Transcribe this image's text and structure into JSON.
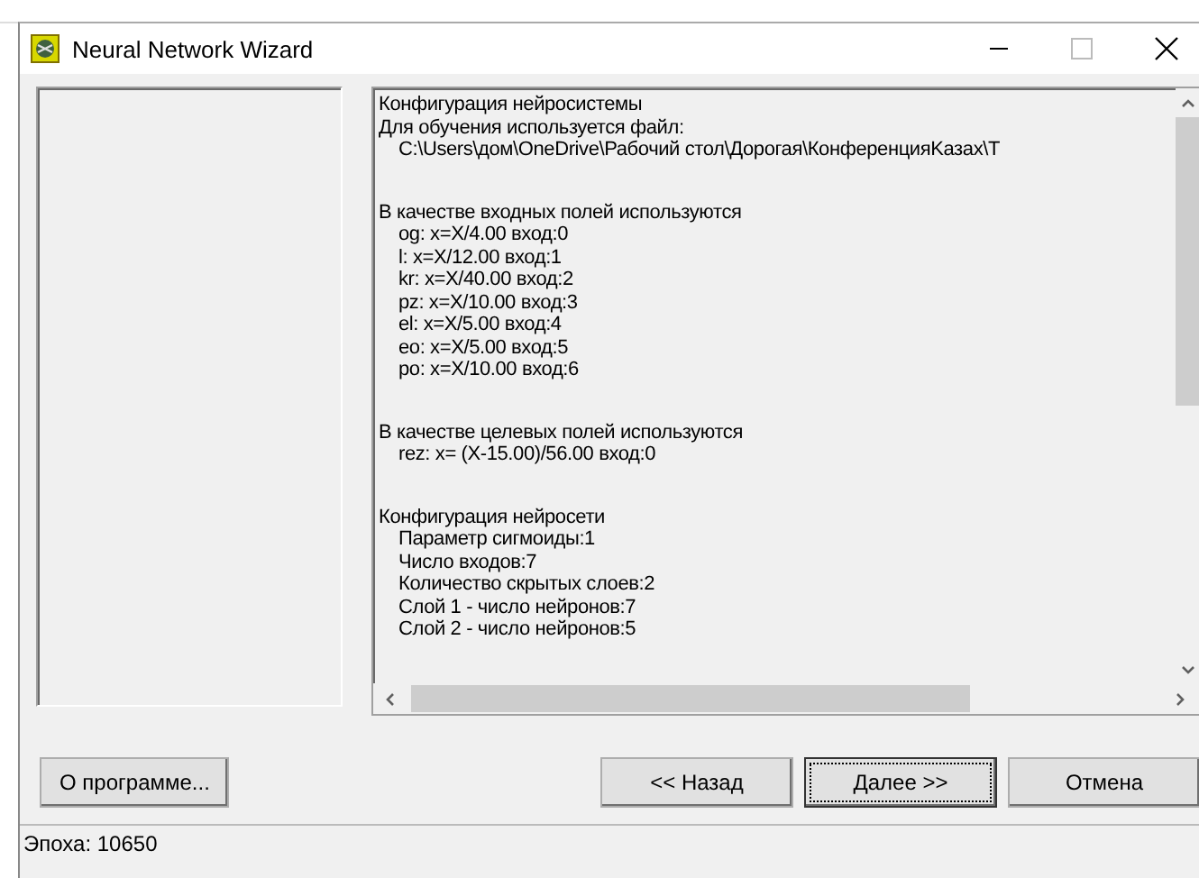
{
  "window": {
    "title": "Neural Network Wizard"
  },
  "log": {
    "sections": [
      {
        "lines": [
          "Конфигурация нейросистемы",
          "Для обучения используется файл:"
        ],
        "children": [
          "C:\\Users\\дом\\OneDrive\\Рабочий стол\\Дорогая\\КонференцияKазах\\T"
        ]
      },
      {
        "lines": [
          "В качестве входных полей используются"
        ],
        "children": [
          "og: x=X/4.00 вход:0",
          "l: x=X/12.00 вход:1",
          "kr: x=X/40.00 вход:2",
          "pz: x=X/10.00 вход:3",
          "el: x=X/5.00 вход:4",
          "eo: x=X/5.00 вход:5",
          "po: x=X/10.00 вход:6"
        ]
      },
      {
        "lines": [
          "В качестве целевых полей используются"
        ],
        "children": [
          "rez: x= (X-15.00)/56.00 вход:0"
        ]
      },
      {
        "lines": [
          "Конфигурация нейросети"
        ],
        "children": [
          "Параметр сигмоиды:1",
          "Число входов:7",
          "Количество скрытых слоев:2",
          "Слой 1 - число нейронов:7",
          "Слой 2 - число нейронов:5"
        ]
      }
    ]
  },
  "buttons": [
    {
      "label": "О программе...",
      "kind": "left",
      "focused": false
    },
    {
      "label": "<< Назад",
      "kind": "right",
      "focused": false
    },
    {
      "label": "Далее >>",
      "kind": "right",
      "focused": true
    },
    {
      "label": "Отмена",
      "kind": "right",
      "focused": false
    }
  ],
  "status_bar": "Эпоха: 10650"
}
